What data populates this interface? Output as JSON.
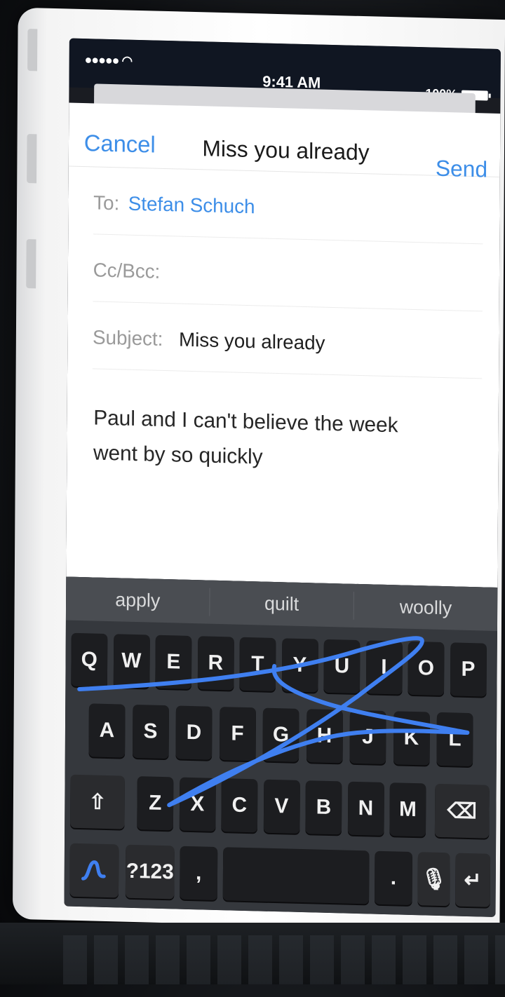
{
  "status_bar": {
    "signal": "●●●●● ",
    "time": "9:41 AM",
    "battery_text": "100%"
  },
  "compose": {
    "cancel_label": "Cancel",
    "title": "Miss you already",
    "send_label": "Send",
    "to_label": "To:",
    "to_value": "Stefan Schuch",
    "ccbcc_label": "Cc/Bcc:",
    "subject_label": "Subject:",
    "subject_value": "Miss you already",
    "body_line1": "Paul and I can't believe the week",
    "body_line2": "went by so quickly"
  },
  "keyboard": {
    "suggestions": [
      "apply",
      "quilt",
      "woolly"
    ],
    "row1": [
      "Q",
      "W",
      "E",
      "R",
      "T",
      "Y",
      "U",
      "I",
      "O",
      "P"
    ],
    "row2": [
      "A",
      "S",
      "D",
      "F",
      "G",
      "H",
      "J",
      "K",
      "L"
    ],
    "row3": [
      "Z",
      "X",
      "C",
      "V",
      "B",
      "N",
      "M"
    ],
    "shift_icon": "⇧",
    "backspace_icon": "⌫",
    "numbers_label": "?123",
    "comma_label": ",",
    "period_label": ".",
    "mic_icon": "🎙",
    "return_icon": "↵",
    "swype_stroke_color": "#3f7ff0"
  }
}
